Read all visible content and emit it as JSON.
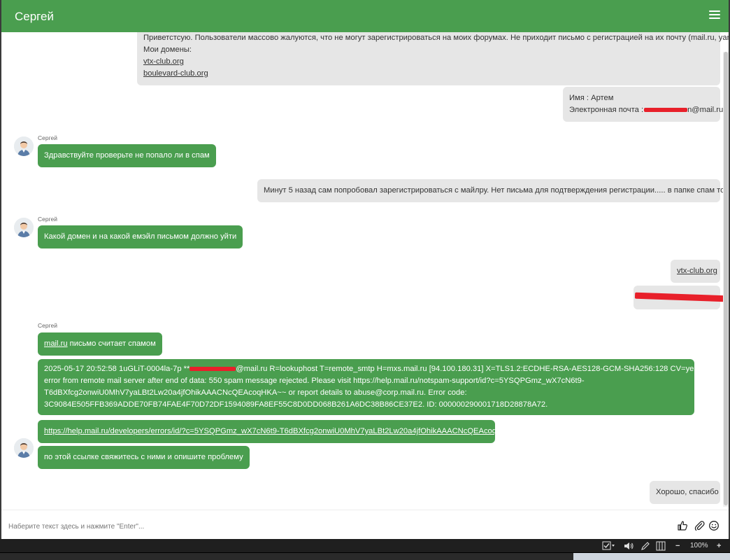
{
  "header": {
    "title": "Сергей"
  },
  "messages": {
    "m1": {
      "line1": "Приветстсую. Пользователи массово жалуются, что не могут зарегистрироваться на моих форумах. Не приходит письмо с регистрацией на их почту (mail.ru, yandex.ru).",
      "line2": "Мои домены:",
      "link1": "vtx-club.org",
      "link2": "boulevard-club.org"
    },
    "m2": {
      "name_line": "Имя : Артем",
      "email_label": "Электронная почта :",
      "email_suffix": "n@mail.ru"
    },
    "m3": {
      "sender": "Сергей",
      "text": "Здравствуйте проверьте не попало ли в спам"
    },
    "m4": {
      "text": "Минут 5 назад сам попробовал зарегистрироваться с майлру. Нет письма для подтверждения регистрации..... в папке спам тоже нет"
    },
    "m5": {
      "sender": "Сергей",
      "text": "Какой домен и на какой емэйл письмом должно уйти"
    },
    "m6": {
      "link": "vtx-club.org"
    },
    "m7": {
      "redacted": ""
    },
    "m8": {
      "sender": "Сергей",
      "link": "mail.ru",
      "text": " письмо считает спамом"
    },
    "m9": {
      "l1_prefix": "2025-05-17 20:52:58 1uGLiT-0004la-7p **",
      "l1_suffix": "@mail.ru R=lookuphost T=remote_smtp H=mxs.mail.ru [94.100.180.31] X=TLS1.2:ECDHE-RSA-AES128-GCM-SHA256:128 CV=yes: SMTP",
      "l2": "error from remote mail server after end of data: 550 spam message rejected. Please visit https://help.mail.ru/notspam-support/id?c=5YSQPGmz_wX7cN6t9-",
      "l3": "T6dBXfcg2onwiU0MhV7yaLBt2Lw20a4jfOhikAAACNcQEAcoqHKA~~ or report details to abuse@corp.mail.ru. Error code:",
      "l4": "3C9084E505FFB369ADDE70FB74FAE4F70D72DF1594089FA8EF55C8D0DD068B261A6DC38B86CE37E2. ID: 000000290001718D28878A72."
    },
    "m10": {
      "link": "https://help.mail.ru/developers/errors/id/?c=5YSQPGmz_wX7cN6t9-T6dBXfcg2onwiU0MhV7yaLBt2Lw20a4jfOhikAAACNcQEAcoqHKA~~"
    },
    "m11": {
      "text": "по этой ссылке свяжитесь с ними и опишите проблему"
    },
    "m12": {
      "text": "Хорошо, спасибо"
    }
  },
  "input": {
    "placeholder": "Наберите текст здесь и нажмите \"Enter\"..."
  },
  "statusbar": {
    "zoom": "100%",
    "minus": "−",
    "plus": "+"
  },
  "icons": {
    "menu": "hamburger-menu-icon",
    "thumbs": "thumbs-up-icon",
    "attach": "paperclip-icon",
    "emoji": "smiley-icon",
    "avatar": "user-avatar-icon"
  },
  "colors": {
    "brand_green": "#4a9e4f",
    "incoming_bg": "#4a9e4f",
    "outgoing_bg": "#e6e6e6",
    "redaction": "#e8202a"
  }
}
